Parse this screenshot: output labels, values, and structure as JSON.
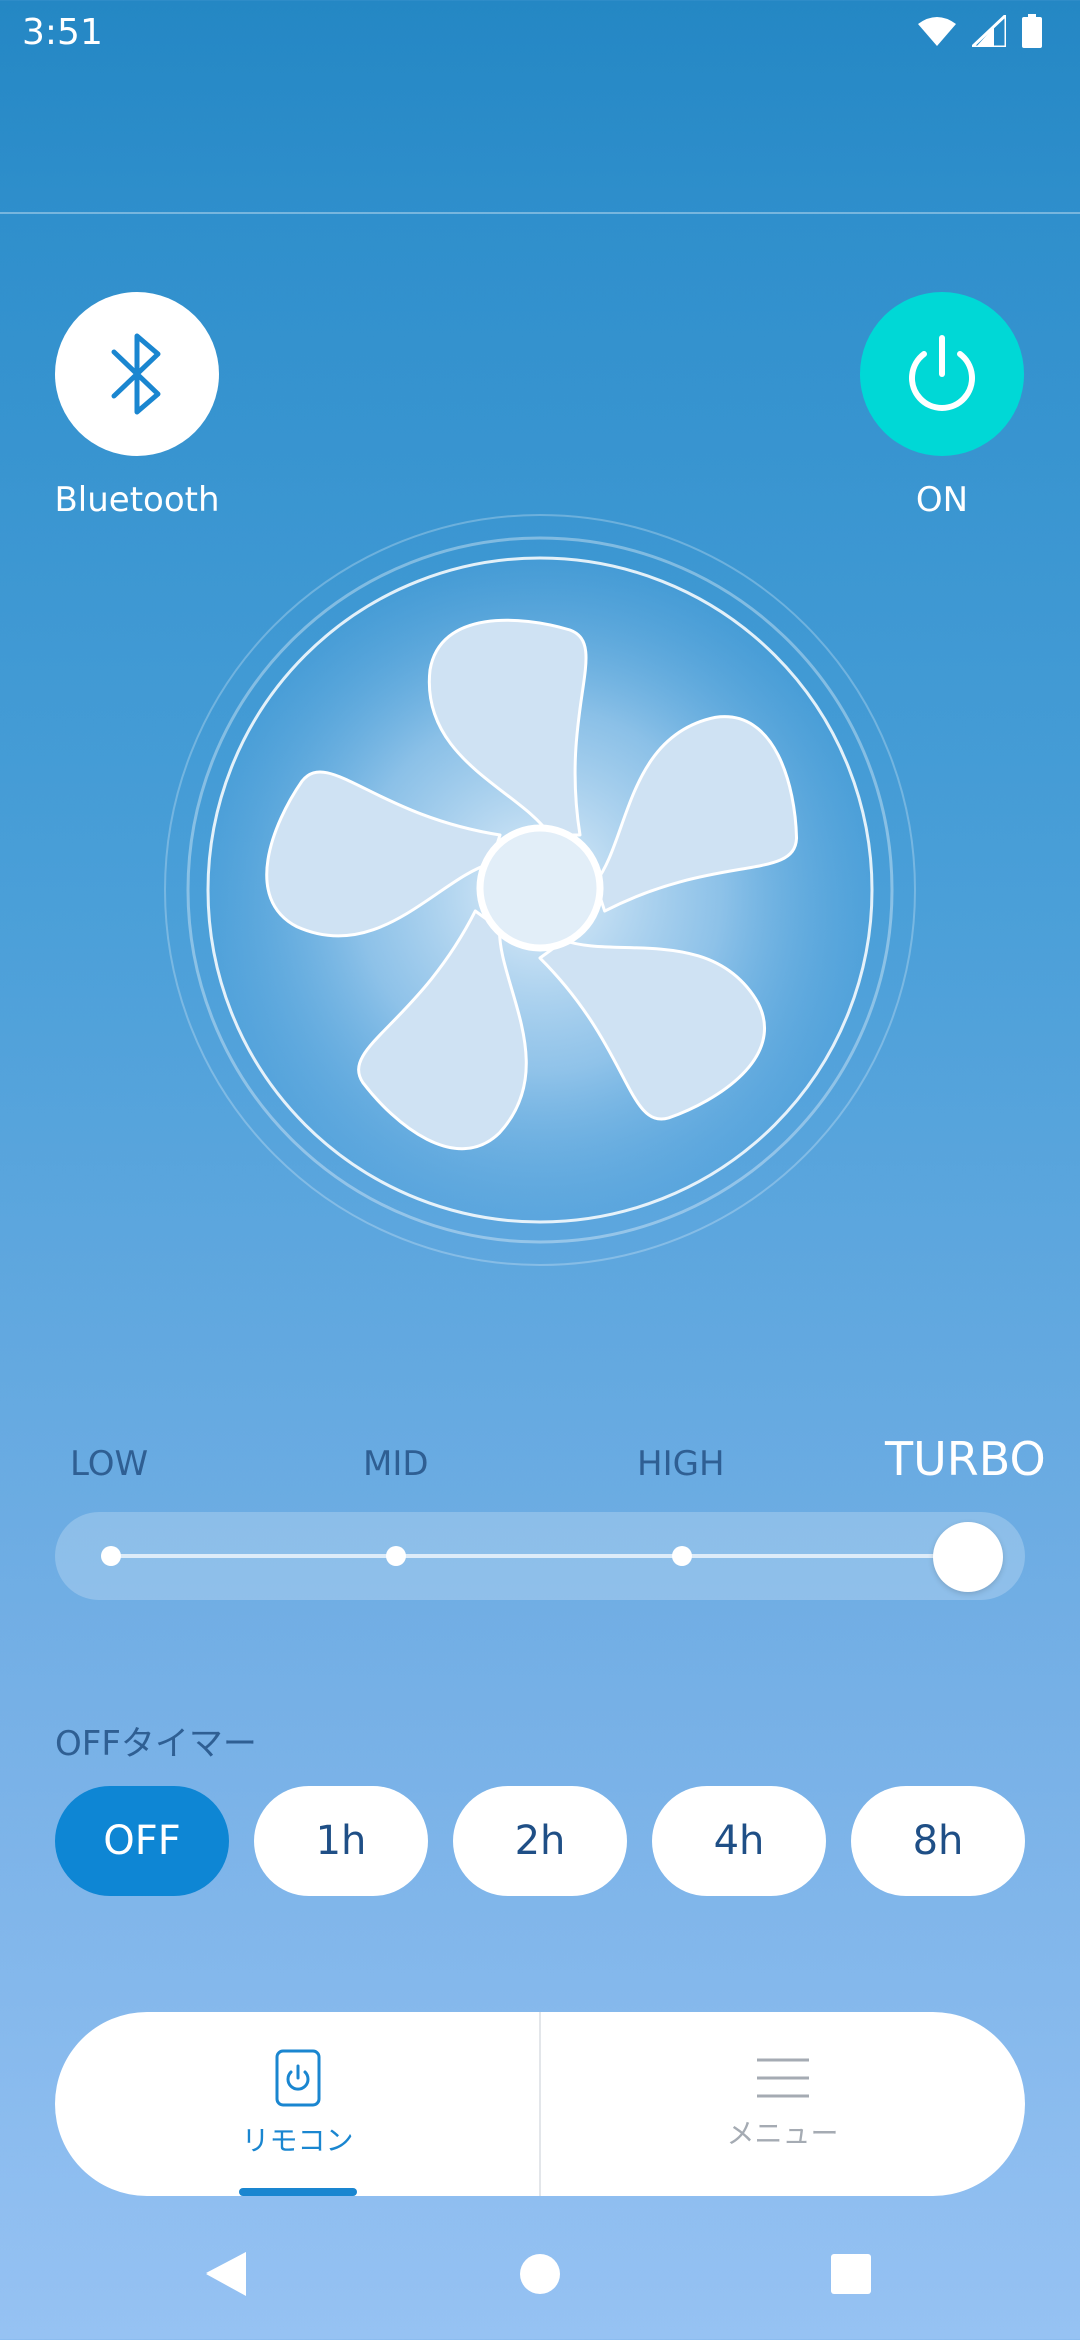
{
  "status_bar": {
    "time": "3:51",
    "icons": [
      "wifi-icon",
      "signal-icon",
      "battery-icon"
    ]
  },
  "bluetooth": {
    "label": "Bluetooth",
    "icon": "bluetooth-icon"
  },
  "power": {
    "label": "ON",
    "icon": "power-icon",
    "state": "on",
    "color": "#00d8d6"
  },
  "fan": {
    "icon": "fan-icon"
  },
  "speed": {
    "levels": [
      "LOW",
      "MID",
      "HIGH",
      "TURBO"
    ],
    "selected": "TURBO",
    "selected_index": 3
  },
  "timer": {
    "title": "OFFタイマー",
    "options": [
      "OFF",
      "1h",
      "2h",
      "4h",
      "8h"
    ],
    "selected": "OFF"
  },
  "bottom_nav": {
    "items": [
      {
        "label": "リモコン",
        "icon": "remote-power-icon",
        "active": true
      },
      {
        "label": "メニュー",
        "icon": "menu-icon",
        "active": false
      }
    ]
  },
  "colors": {
    "accent": "#1a86d0",
    "power_on": "#00d8d6",
    "selected_timer": "#0e86d4"
  },
  "system_nav": {
    "icons": [
      "back-icon",
      "home-icon",
      "recents-icon"
    ]
  }
}
